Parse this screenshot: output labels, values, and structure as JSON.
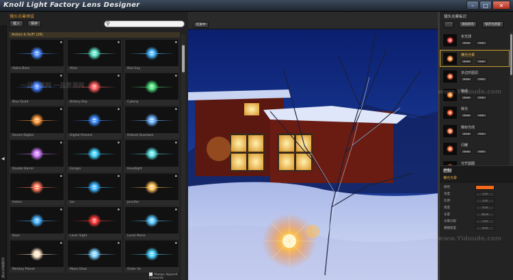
{
  "app": {
    "title": "Knoll Light Factory Lens Designer"
  },
  "window_buttons": {
    "minimize": "–",
    "maximize": "□",
    "close": "✕"
  },
  "left_panel": {
    "header": "镜头光晕预设",
    "load_button": "载入",
    "save_button": "保存",
    "search_icon": "⚲",
    "category": "Action & SciFi (26)",
    "side_arrow": "◀",
    "side_label": "镜头光晕预设",
    "append_label": "Always Append Elements",
    "presets": [
      {
        "name": "Alpha Base",
        "color": "#4c8cff"
      },
      {
        "name": "Alion",
        "color": "#5ee6c8"
      },
      {
        "name": "Bad Guy",
        "color": "#4ab8ff"
      },
      {
        "name": "Blue Quad",
        "color": "#3a78ff"
      },
      {
        "name": "Botany Bay",
        "color": "#ff5a5a"
      },
      {
        "name": "Cyborg",
        "color": "#4adf7c"
      },
      {
        "name": "Desert Digital",
        "color": "#ff9a3c"
      },
      {
        "name": "Digital Present",
        "color": "#3c8cff"
      },
      {
        "name": "Distant Quantum",
        "color": "#6cb4ff"
      },
      {
        "name": "Double Barrel",
        "color": "#d27cff"
      },
      {
        "name": "Escape",
        "color": "#3cd2ff"
      },
      {
        "name": "Headlight",
        "color": "#5ce2e6"
      },
      {
        "name": "Helion",
        "color": "#ff7a5c"
      },
      {
        "name": "Ion",
        "color": "#3cb4ff"
      },
      {
        "name": "Jennifer",
        "color": "#ffc35a"
      },
      {
        "name": "Kaon",
        "color": "#4ab4ff"
      },
      {
        "name": "Laser Sight",
        "color": "#ff3a3a"
      },
      {
        "name": "Lunar Noise",
        "color": "#5ac8ff"
      },
      {
        "name": "Monkey Planet",
        "color": "#ffe6c8"
      },
      {
        "name": "Moon Glow",
        "color": "#7cd2ff"
      },
      {
        "name": "Order Vo",
        "color": "#4ad2ff"
      }
    ]
  },
  "center": {
    "toolbar_button": "在屏中"
  },
  "right_panel": {
    "header": "镜头光晕标识",
    "btn_clear": "清除所有",
    "btn_save": "保存为新版",
    "element_btn1": "show",
    "element_btn2": "hide",
    "elements": [
      {
        "name": "实光球",
        "color": "#ff4040"
      },
      {
        "name": "横光光晕",
        "color": "#ff8a3a"
      },
      {
        "name": "多边形圆滤",
        "color": "#ff6a3a"
      },
      {
        "name": "散线",
        "color": "#ff8a2a"
      },
      {
        "name": "辉光",
        "color": "#ff5a2a"
      },
      {
        "name": "散射光线",
        "color": "#ff7a4a"
      },
      {
        "name": "闪耀",
        "color": "#ff6a3a"
      },
      {
        "name": "光芒圆圈",
        "color": "#ff7a3a"
      }
    ],
    "properties_title": "控制",
    "properties_subtitle": "横光光晕",
    "props": [
      {
        "label": "颜色",
        "value": "",
        "swatch": "#f26a1a"
      },
      {
        "label": "亮度",
        "value": "1.00"
      },
      {
        "label": "比例",
        "value": "1.00"
      },
      {
        "label": "角度",
        "value": "0.00"
      },
      {
        "label": "长度",
        "value": "36.00"
      },
      {
        "label": "光晕分裂",
        "value": "1.00"
      },
      {
        "label": "模糊程度",
        "value": "0.00"
      }
    ]
  },
  "watermarks": [
    "www.Yidoude.com",
    "www.Yidoude.com",
    "一品资源网 一品资源网"
  ]
}
